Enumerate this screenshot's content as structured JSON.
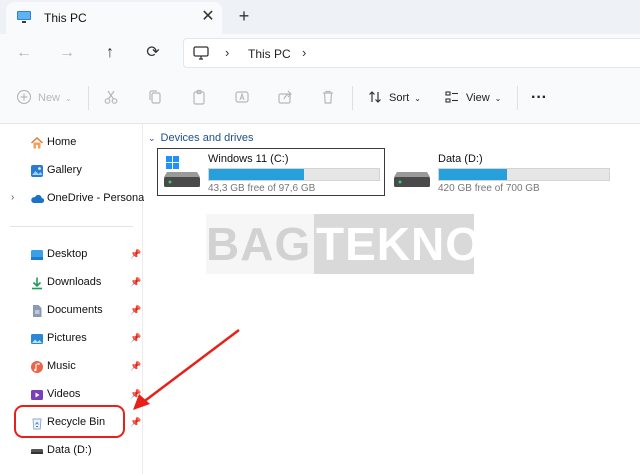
{
  "window": {
    "tab_title": "This PC",
    "tab_close": "✕",
    "new_tab": "+"
  },
  "nav": {
    "back": "←",
    "forward": "→",
    "up": "↑",
    "refresh": "⟳",
    "breadcrumb": "This PC",
    "chevron": "›"
  },
  "commandbar": {
    "new_label": "New",
    "sort_label": "Sort",
    "view_label": "View",
    "more": "···",
    "caret": "⌄",
    "icons": [
      "cut-icon",
      "copy-icon",
      "paste-icon",
      "rename-icon",
      "share-icon",
      "delete-icon"
    ]
  },
  "sidebar": {
    "top_items": [
      {
        "label": "Home",
        "icon": "home-icon"
      },
      {
        "label": "Gallery",
        "icon": "gallery-icon"
      },
      {
        "label": "OneDrive - Personal",
        "icon": "cloud-icon",
        "expander": "›"
      }
    ],
    "quick_items": [
      {
        "label": "Desktop",
        "icon": "desktop-icon",
        "pin": "📌"
      },
      {
        "label": "Downloads",
        "icon": "download-icon",
        "pin": "📌"
      },
      {
        "label": "Documents",
        "icon": "document-icon",
        "pin": "📌"
      },
      {
        "label": "Pictures",
        "icon": "pictures-icon",
        "pin": "📌"
      },
      {
        "label": "Music",
        "icon": "music-icon",
        "pin": "📌"
      },
      {
        "label": "Videos",
        "icon": "video-icon",
        "pin": "📌"
      },
      {
        "label": "Recycle Bin",
        "icon": "recycle-bin-icon",
        "pin": "📌"
      },
      {
        "label": "Data (D:)",
        "icon": "drive-icon"
      }
    ]
  },
  "main": {
    "group_title": "Devices and drives",
    "group_chevron": "⌄",
    "drives": [
      {
        "name": "Windows 11 (C:)",
        "free_text": "43,3 GB free of 97,6 GB",
        "used_fraction": 0.556,
        "selected": true
      },
      {
        "name": "Data (D:)",
        "free_text": "420 GB free of 700 GB",
        "used_fraction": 0.4,
        "selected": false
      }
    ]
  },
  "watermark": {
    "part1": "BAGI",
    "part2": "TEKNO"
  },
  "colors": {
    "accent": "#26a0da",
    "annotation": "#e8201a",
    "header_blue": "#1f4e8c"
  }
}
